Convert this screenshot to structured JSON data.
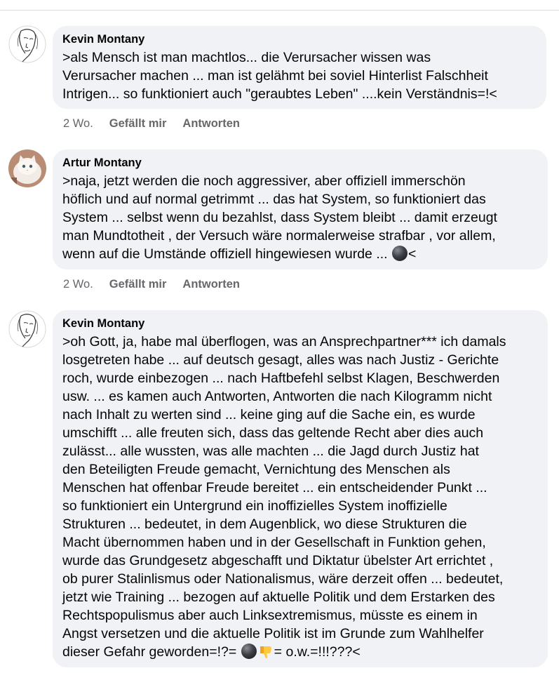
{
  "comments": [
    {
      "author": "Kevin Montany",
      "avatar_icon": "face-sketch-icon",
      "text": ">als Mensch ist man machtlos... die Verursacher wissen was\nVerursacher machen ... man ist gelähmt bei soviel Hinterlist Falschheit\nIntrigen... so funktioniert auch \"geraubtes Leben\" ....kein Verständnis=!<",
      "time": "2 Wo.",
      "like_label": "Gefällt mir",
      "reply_label": "Antworten"
    },
    {
      "author": "Artur Montany",
      "avatar_icon": "white-cat-photo",
      "text_before_emoji": ">naja, jetzt werden die noch aggressiver, aber offiziell immerschön\nhöflich und auf normal getrimmt ... das hat System, so funktioniert das\nSystem ... selbst wenn du bezahlst, dass System bleibt ... damit erzeugt\nman Mundtotheit , der Versuch wäre normalerweise strafbar , vor allem,\nwenn auf die Umstände offiziell hingewiesen wurde ... ",
      "emoji": "black-ball-emoji",
      "text_after_emoji": "<",
      "time": "2 Wo.",
      "like_label": "Gefällt mir",
      "reply_label": "Antworten"
    },
    {
      "author": "Kevin Montany",
      "avatar_icon": "face-sketch-icon",
      "text_before_emoji": ">oh Gott, ja, habe mal überflogen, was an Ansprechpartner*** ich damals\nlosgetreten habe ... auf deutsch gesagt, alles was nach Justiz - Gerichte\nroch, wurde einbezogen ... nach Haftbefehl selbst Klagen, Beschwerden\nusw. ... es kamen auch Antworten, Antworten die nach Kilogramm nicht\nnach Inhalt zu werten sind ... keine ging auf die Sache ein, es wurde\numschifft ... alle freuten sich, dass das geltende Recht aber dies auch\nzulässt... alle wussten, was alle machten ... die Jagd durch Justiz hat\nden Beteiligten Freude gemacht, Vernichtung des Menschen als\nMenschen hat offenbar Freude bereitet ... ein entscheidender Punkt  ...\nso funktioniert ein Untergrund ein inoffizielles System inoffizielle\nStrukturen ... bedeutet, in dem Augenblick, wo diese Strukturen die\nMacht übernommen haben und in der Gesellschaft in Funktion gehen,\nwurde das Grundgesetz abgeschafft und Diktatur übelster Art errichtet ,\nob purer Stalinlismus oder Nationalismus, wäre derzeit offen ... bedeutet,\njetzt wie Training ... bezogen auf aktuelle Politik und dem Erstarken des\nRechtspopulismus aber auch Linksextremismus, müsste es einem in\nAngst versetzen und die aktuelle Politik ist im Grunde zum Wahlhelfer\ndieser Gefahr geworden=!?= ",
      "emoji_1": "black-ball-emoji",
      "emoji_2": "thumbs-down-emoji",
      "text_after_emoji": "= o.w.=!!!???<"
    }
  ],
  "colors": {
    "bubble_bg": "#f0f2f5",
    "meta_text": "#65676b",
    "divider": "#dadde1"
  }
}
